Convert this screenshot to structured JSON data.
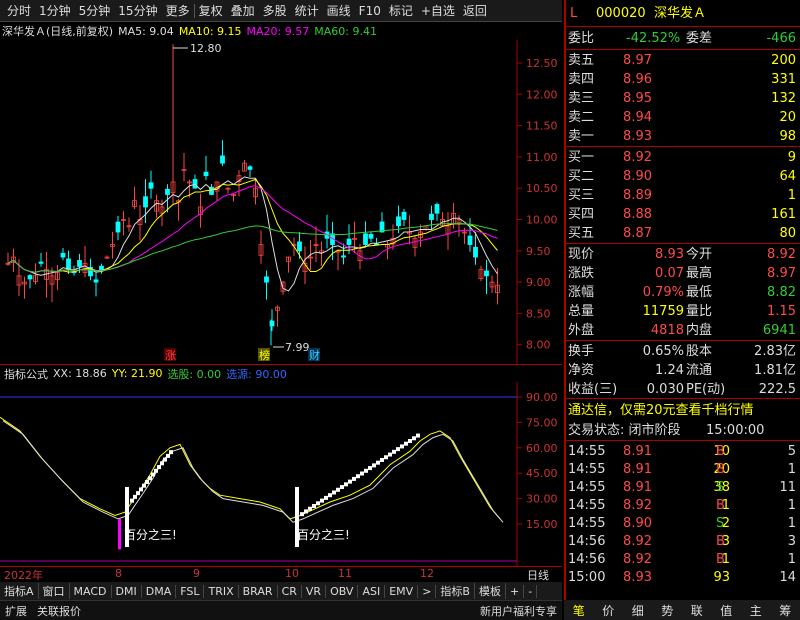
{
  "toolbar": {
    "items": [
      "分时",
      "1分钟",
      "5分钟",
      "15分钟",
      "更多",
      "复权",
      "叠加",
      "多股",
      "统计",
      "画线",
      "F10",
      "标记",
      "+自选",
      "返回"
    ]
  },
  "chart": {
    "title": "深华发Ａ(日线,前复权)",
    "ma5": "MA5: 9.04",
    "ma10": "MA10: 9.15",
    "ma20": "MA20: 9.57",
    "ma60": "MA60: 9.41",
    "y_ticks": [
      "12.50",
      "12.00",
      "11.50",
      "11.00",
      "10.50",
      "10.00",
      "9.50",
      "9.00",
      "8.50",
      "8.00"
    ],
    "high_label": "12.80",
    "low_label": "7.99",
    "markers": [
      "涨",
      "榜",
      "财"
    ],
    "x_labels": [
      "2022年",
      "8",
      "9",
      "10",
      "11",
      "12",
      "日线"
    ]
  },
  "indicator": {
    "name": "指标公式",
    "xx": "XX: 18.86",
    "yy": "YY: 21.90",
    "pick": "选股: 0.00",
    "src": "选源: 90.00",
    "y_ticks": [
      "90.00",
      "75.00",
      "60.00",
      "45.00",
      "30.00",
      "15.00"
    ],
    "signal_text": "百分之三!"
  },
  "bottom_tabs": [
    "指标A",
    "窗口",
    "MACD",
    "DMI",
    "DMA",
    "FSL",
    "TRIX",
    "BRAR",
    "CR",
    "VR",
    "OBV",
    "ASI",
    "EMV",
    ">",
    "指标B",
    "模板",
    "+",
    "-"
  ],
  "status_bar": [
    "扩展",
    "关联报价"
  ],
  "promo": "新用户福利专享",
  "quote": {
    "code": "000020",
    "name": "深华发Ａ",
    "weibi_label": "委比",
    "weibi": "-42.52%",
    "weicha_label": "委差",
    "weicha": "-466",
    "asks": [
      {
        "label": "卖五",
        "price": "8.97",
        "vol": "200"
      },
      {
        "label": "卖四",
        "price": "8.96",
        "vol": "331"
      },
      {
        "label": "卖三",
        "price": "8.95",
        "vol": "132"
      },
      {
        "label": "卖二",
        "price": "8.94",
        "vol": "20"
      },
      {
        "label": "卖一",
        "price": "8.93",
        "vol": "98"
      }
    ],
    "bids": [
      {
        "label": "买一",
        "price": "8.92",
        "vol": "9"
      },
      {
        "label": "买二",
        "price": "8.90",
        "vol": "64"
      },
      {
        "label": "买三",
        "price": "8.89",
        "vol": "1"
      },
      {
        "label": "买四",
        "price": "8.88",
        "vol": "161"
      },
      {
        "label": "买五",
        "price": "8.87",
        "vol": "80"
      }
    ],
    "stats": [
      {
        "l1": "现价",
        "v1": "8.93",
        "c1": "red",
        "l2": "今开",
        "v2": "8.92",
        "c2": "red"
      },
      {
        "l1": "涨跌",
        "v1": "0.07",
        "c1": "red",
        "l2": "最高",
        "v2": "8.97",
        "c2": "red"
      },
      {
        "l1": "涨幅",
        "v1": "0.79%",
        "c1": "red",
        "l2": "最低",
        "v2": "8.82",
        "c2": "green"
      },
      {
        "l1": "总量",
        "v1": "11759",
        "c1": "yellow",
        "l2": "量比",
        "v2": "1.15",
        "c2": "red"
      },
      {
        "l1": "外盘",
        "v1": "4818",
        "c1": "red",
        "l2": "内盘",
        "v2": "6941",
        "c2": "green"
      }
    ],
    "stats2": [
      {
        "l1": "换手",
        "v1": "0.65%",
        "l2": "股本",
        "v2": "2.83亿"
      },
      {
        "l1": "净资",
        "v1": "1.24",
        "l2": "流通",
        "v2": "1.81亿"
      },
      {
        "l1": "收益(三)",
        "v1": "0.030",
        "l2": "PE(动)",
        "v2": "222.5"
      }
    ],
    "ad": "通达信，仅需20元查看千档行情",
    "trade_state_label": "交易状态: 闭市阶段",
    "trade_state_time": "15:00:00",
    "ticks": [
      {
        "t": "14:55",
        "p": "8.91",
        "v": "10",
        "bs": "B"
      },
      {
        "t": "14:55",
        "p": "8.91",
        "v": "20",
        "bs": "B"
      },
      {
        "t": "14:55",
        "p": "8.91",
        "v": "38",
        "bs": "S"
      },
      {
        "t": "14:55",
        "p": "8.92",
        "v": "1",
        "bs": "B"
      },
      {
        "t": "14:55",
        "p": "8.90",
        "v": "2",
        "bs": "S"
      },
      {
        "t": "14:56",
        "p": "8.92",
        "v": "3",
        "bs": "B"
      },
      {
        "t": "14:56",
        "p": "8.92",
        "v": "1",
        "bs": "B"
      },
      {
        "t": "15:00",
        "p": "8.93",
        "v": "93",
        "bs": ""
      }
    ],
    "tick_extra": [
      "5",
      "1",
      "11",
      "1",
      "1",
      "3",
      "1",
      "14"
    ],
    "tabs": [
      "笔",
      "价",
      "细",
      "势",
      "联",
      "值",
      "主",
      "筹"
    ]
  }
}
